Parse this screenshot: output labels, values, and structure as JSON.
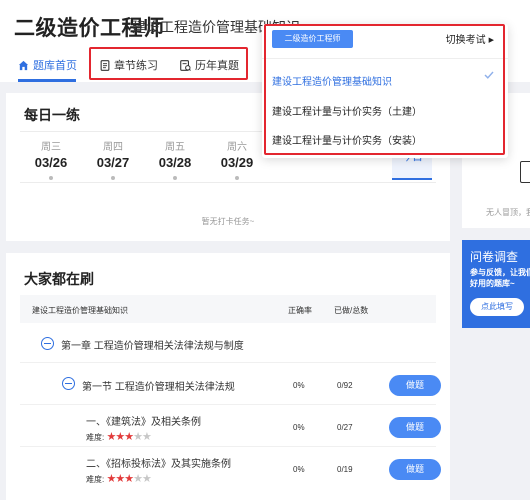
{
  "header": {
    "title": "二级造价工程师",
    "subject": "建设工程造价管理基础知识"
  },
  "tabs": [
    {
      "label": "题库首页",
      "icon": "home-icon"
    },
    {
      "label": "章节练习",
      "icon": "document-icon"
    },
    {
      "label": "历年真题",
      "icon": "exam-paper-icon"
    }
  ],
  "daily": {
    "title": "每日一练",
    "days": [
      {
        "weekday": "周三",
        "date": "03/26"
      },
      {
        "weekday": "周四",
        "date": "03/27"
      },
      {
        "weekday": "周五",
        "date": "03/28"
      },
      {
        "weekday": "周六",
        "date": "03/29"
      }
    ],
    "today_label": "今日",
    "empty_text": "暂无打卡任务~"
  },
  "popular": {
    "title": "大家都在刷",
    "columns": {
      "name": "建设工程造价管理基础知识",
      "accuracy": "正确率",
      "done": "已做/总数"
    },
    "rows": [
      {
        "name": "第一章 工程造价管理相关法律法规与制度"
      },
      {
        "name": "第一节 工程造价管理相关法律法规",
        "accuracy": "0%",
        "done": "0/92",
        "button": "做题"
      },
      {
        "name": "一、《建筑法》及相关条例",
        "difficulty_label": "难度:",
        "stars": 3,
        "accuracy": "0%",
        "done": "0/27",
        "button": "做题"
      },
      {
        "name": "二、《招标投标法》及其实施条例",
        "difficulty_label": "难度:",
        "stars": 3,
        "accuracy": "0%",
        "done": "0/19",
        "button": "做题"
      }
    ]
  },
  "side": {
    "empty_text": "无人冒顶，我",
    "survey": {
      "title": "问卷调查",
      "desc_line1": "参与反馈，让我们",
      "desc_line2": "好用的题库~",
      "button": "点此填写"
    }
  },
  "dropdown": {
    "level_button": "二级造价工程师",
    "switch_label": "切换考试",
    "items": [
      "建设工程造价管理基础知识",
      "建设工程计量与计价实务（土建）",
      "建设工程计量与计价实务（安装）"
    ],
    "selected_index": 0
  },
  "colors": {
    "accent": "#2f6fe0",
    "button": "#4a8af4",
    "highlight_box": "#e3262f",
    "star": "#e23b3b"
  }
}
